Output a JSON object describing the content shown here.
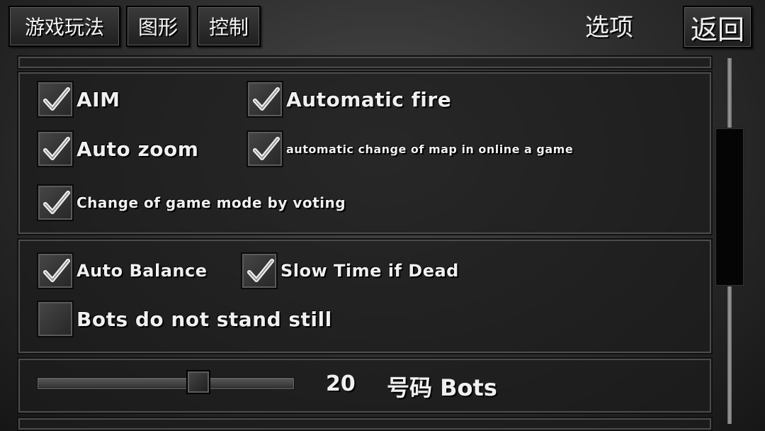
{
  "tabs": [
    "游戏玩法",
    "图形",
    "控制"
  ],
  "title": "选项",
  "back_label": "返回",
  "group1": {
    "aim": {
      "label": "AIM",
      "checked": true
    },
    "automatic_fire": {
      "label": "Automatic fire",
      "checked": true
    },
    "auto_zoom": {
      "label": "Auto zoom",
      "checked": true
    },
    "auto_map_change": {
      "label": "automatic change of map in online a game",
      "checked": true
    },
    "mode_voting": {
      "label": "Change of game mode by voting",
      "checked": true
    }
  },
  "group2": {
    "auto_balance": {
      "label": "Auto Balance",
      "checked": true
    },
    "slow_time": {
      "label": "Slow Time if Dead",
      "checked": true
    },
    "bots_move": {
      "label": "Bots do not stand still",
      "checked": false
    }
  },
  "bots": {
    "value": "20",
    "label": "号码 Bots",
    "slider_fraction": 0.63
  },
  "colors": {
    "text": "#f0f0f0",
    "panel": "#1c1c1c",
    "scroll_thumb": "#050505"
  },
  "icons": {
    "checkbox": "checkmark-icon"
  }
}
